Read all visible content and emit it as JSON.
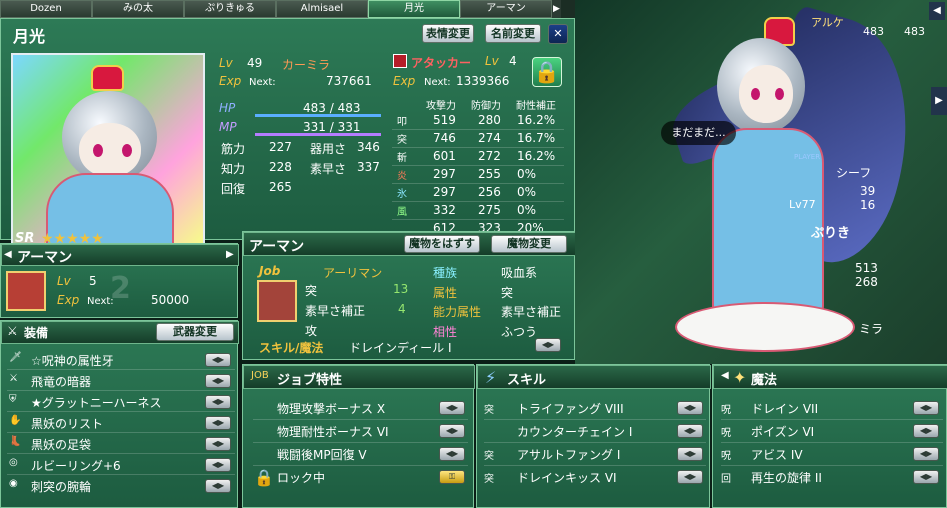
{
  "tabs": [
    "Dozen",
    "みの太",
    "ぷりきゅる",
    "Almisael",
    "月光",
    "アーマン"
  ],
  "character": {
    "name": "月光",
    "rank": "SR",
    "stars": "★★★★★",
    "lv_label": "Lv",
    "lv": "49",
    "race": "カーミラ",
    "exp_label": "Exp",
    "next_label": "Next:",
    "exp_next": "737661",
    "hp_label": "HP",
    "hp": "483 / 483",
    "mp_label": "MP",
    "mp": "331 / 331",
    "stats": [
      [
        "筋力",
        "227"
      ],
      [
        "器用さ",
        "346"
      ],
      [
        "知力",
        "228"
      ],
      [
        "素早さ",
        "337"
      ],
      [
        "回復",
        "265"
      ]
    ],
    "buttons": {
      "expression": "表情変更",
      "rename": "名前変更",
      "close": "✕"
    }
  },
  "master": {
    "class": "アタッカー",
    "lv_label": "Lv",
    "lv": "4",
    "exp_label": "Exp",
    "next_label": "Next:",
    "exp_next": "1339366"
  },
  "resist": {
    "headers": [
      "攻撃力",
      "防御力",
      "耐性補正"
    ],
    "rows": [
      [
        "叩",
        "519",
        "280",
        "16.2%"
      ],
      [
        "突",
        "746",
        "274",
        "16.7%"
      ],
      [
        "斬",
        "601",
        "272",
        "16.2%"
      ],
      [
        "炎",
        "297",
        "255",
        "0%"
      ],
      [
        "氷",
        "297",
        "256",
        "0%"
      ],
      [
        "風",
        "332",
        "275",
        "0%"
      ],
      [
        "",
        "612",
        "323",
        "20%"
      ]
    ]
  },
  "monster": {
    "name": "アーマン",
    "lv_label": "Lv",
    "lv": "5",
    "exp_label": "Exp",
    "next_label": "Next:",
    "exp_next": "50000",
    "number": "2",
    "remove": "魔物をはずす",
    "change": "魔物変更",
    "job_label": "Job",
    "job": "アーリマン",
    "attack_type": "突",
    "attack_value": "13",
    "bonus_stat": "素早さ補正",
    "bonus_value": "4",
    "race_label": "種族",
    "race": "吸血系",
    "attr_label": "属性",
    "attr": "突",
    "ability_label": "能力属性",
    "ability": "素早さ補正",
    "affinity_label": "相性",
    "affinity": "ふつう",
    "skill_label": "スキル/魔法",
    "skill": "ドレインディール I"
  },
  "equipment": {
    "title": "装備",
    "change": "武器変更",
    "items": [
      "☆呪神の属性牙",
      "飛竜の暗器",
      "★グラットニーハーネス",
      "黒妖のリスト",
      "黒妖の足袋",
      "ルビーリング+6",
      "刺突の腕輪"
    ]
  },
  "job_traits": {
    "title": "ジョブ特性",
    "items": [
      "物理攻撃ボーナス X",
      "物理耐性ボーナス VI",
      "戦闘後MP回復 V",
      "ロック中"
    ]
  },
  "skills": {
    "title": "スキル",
    "items": [
      "トライファング VIII",
      "カウンターチェイン I",
      "アサルトファング I",
      "ドレインキッス VI"
    ]
  },
  "magic": {
    "title": "魔法",
    "items": [
      "ドレイン VII",
      "ポイズン VI",
      "アビス IV",
      "再生の旋律 II"
    ]
  },
  "scene": {
    "label_top": "アルケ",
    "hp_top": "483",
    "mp_top": "483",
    "speech": "まだまだ...",
    "player_tag": "PLAYER",
    "ally_name": "シーフ",
    "hp_ally": "39",
    "mp_ally": "16",
    "lv_ally": "Lv77",
    "side_name": "ぷりき",
    "side_hp": "513",
    "side_mp": "268",
    "side_bottom": "ミラ"
  }
}
